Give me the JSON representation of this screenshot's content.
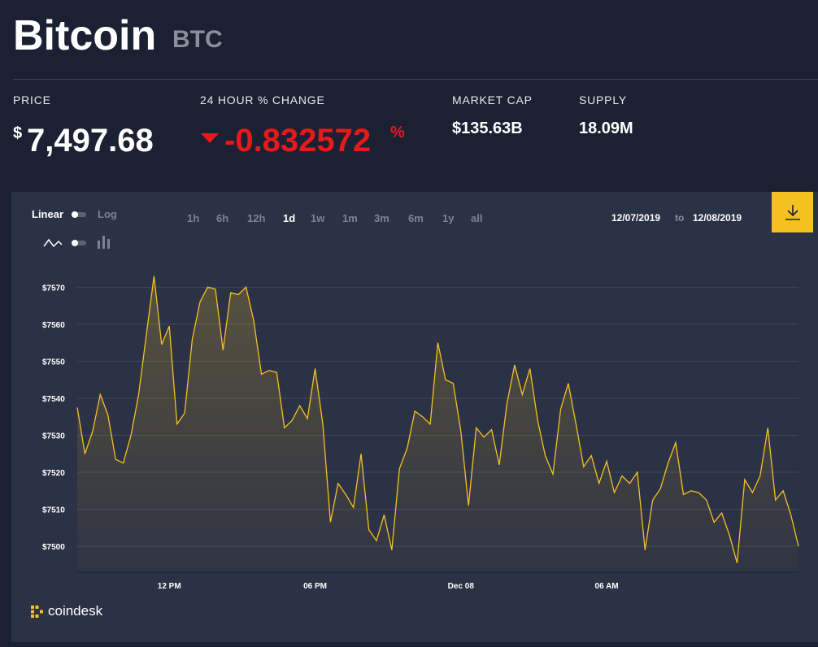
{
  "coin": {
    "name": "Bitcoin",
    "ticker": "BTC"
  },
  "stats": {
    "price_label": "PRICE",
    "price_symbol": "$",
    "price_value": "7,497.68",
    "change_label": "24 HOUR % CHANGE",
    "change_value": "-0.832572",
    "change_unit": "%",
    "market_cap_label": "MARKET CAP",
    "market_cap_value": "$135.63B",
    "supply_label": "SUPPLY",
    "supply_value": "18.09M"
  },
  "colors": {
    "background": "#1b2033",
    "panel": "#2c3245",
    "accent": "#f5c121",
    "negative": "#e8191b",
    "muted": "#7d8294"
  },
  "controls": {
    "scale_linear": "Linear",
    "scale_log": "Log",
    "line_icon": "line-chart-icon",
    "bar_icon": "bar-chart-icon",
    "ranges": [
      "1h",
      "6h",
      "12h",
      "1d",
      "1w",
      "1m",
      "3m",
      "6m",
      "1y",
      "all"
    ],
    "active_range": "1d",
    "date_from": "12/07/2019",
    "date_sep": "to",
    "date_to": "12/08/2019",
    "download_icon": "download-icon"
  },
  "brand": {
    "name": "coindesk",
    "icon": "coindesk-logo-icon"
  },
  "chart_data": {
    "type": "area",
    "x_tick_labels": [
      "12 PM",
      "06 PM",
      "Dec 08",
      "06 AM"
    ],
    "x_tick_index": [
      12,
      31,
      50,
      69
    ],
    "yticks": [
      7500,
      7510,
      7520,
      7530,
      7540,
      7550,
      7560,
      7570
    ],
    "y_tick_prefix": "$",
    "ylim": [
      7493,
      7576
    ],
    "grid": true,
    "series": [
      {
        "values": [
          7537.5,
          7525,
          7531,
          7541,
          7535.5,
          7523.5,
          7522.5,
          7530,
          7541,
          7557,
          7573,
          7554.5,
          7559.5,
          7533,
          7536,
          7556,
          7566,
          7570,
          7569.5,
          7553,
          7568.5,
          7568,
          7570,
          7561,
          7546.5,
          7547.5,
          7547,
          7532,
          7534,
          7538,
          7534.5,
          7548,
          7533,
          7506.5,
          7517,
          7514,
          7510.5,
          7525,
          7504.5,
          7501.5,
          7508.5,
          7499,
          7521,
          7526.5,
          7536.5,
          7535,
          7533,
          7555,
          7545,
          7544,
          7531,
          7511,
          7532,
          7529.5,
          7531.5,
          7522,
          7538.5,
          7549,
          7541,
          7548,
          7534,
          7524.5,
          7519.5,
          7537,
          7544,
          7533,
          7521.5,
          7524.5,
          7517,
          7523,
          7514.5,
          7519,
          7517,
          7520,
          7499,
          7512.5,
          7515.5,
          7522.5,
          7528,
          7514,
          7515,
          7514.5,
          7512.5,
          7506.5,
          7509,
          7503,
          7495.5,
          7518,
          7514.5,
          7519,
          7532,
          7512.5,
          7515,
          7508.5,
          7500
        ]
      }
    ]
  }
}
